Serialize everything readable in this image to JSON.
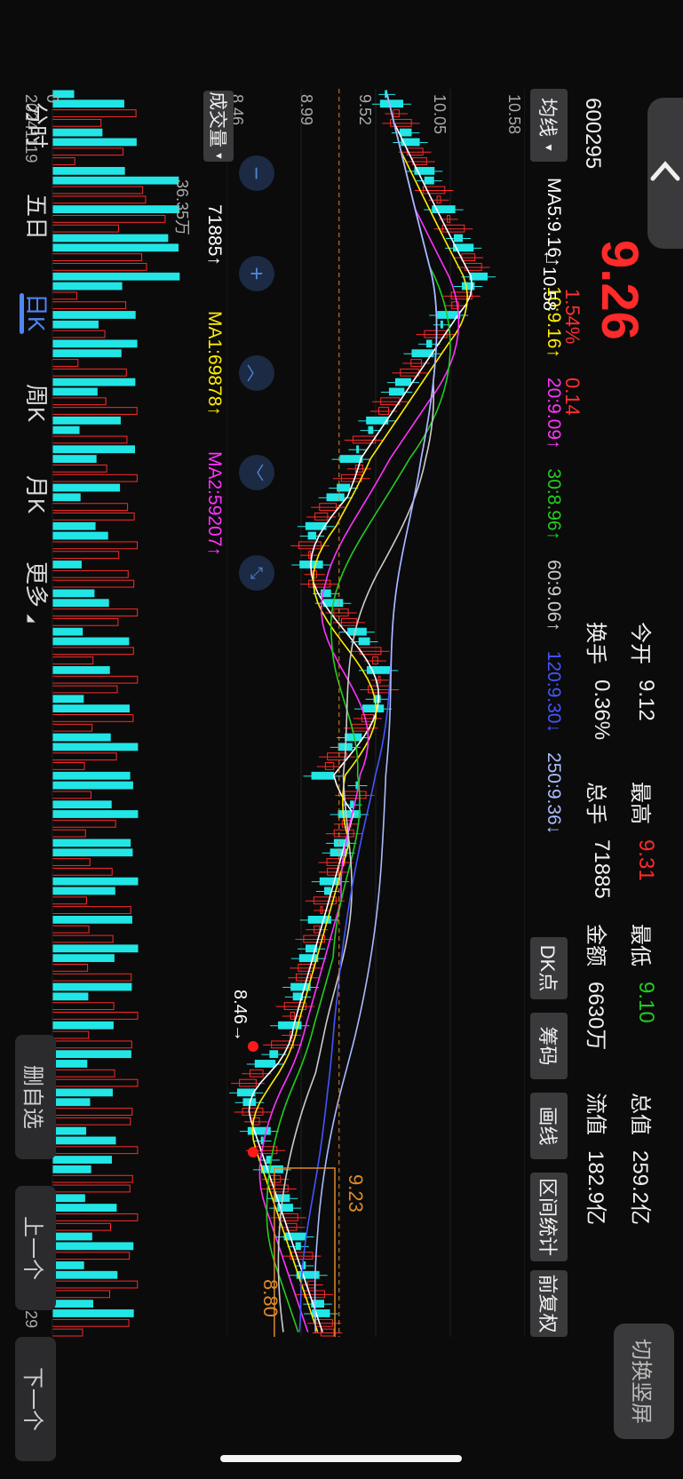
{
  "header": {
    "code": "600295",
    "price": "9.26",
    "change_pct": "1.54%",
    "change_abs": "0.14",
    "quotes": [
      {
        "label": "今开",
        "value": "9.12",
        "color": "#f0f0f0"
      },
      {
        "label": "最高",
        "value": "9.31",
        "color": "#ff2a2a"
      },
      {
        "label": "最低",
        "value": "9.10",
        "color": "#22cc22"
      },
      {
        "label": "总值",
        "value": "259.2亿",
        "color": "#f0f0f0"
      },
      {
        "label": "换手",
        "value": "0.36%",
        "color": "#f0f0f0"
      },
      {
        "label": "总手",
        "value": "71885",
        "color": "#f0f0f0"
      },
      {
        "label": "金额",
        "value": "6630万",
        "color": "#f0f0f0"
      },
      {
        "label": "流值",
        "value": "182.9亿",
        "color": "#f0f0f0"
      }
    ],
    "switch_label": "切换竖屏"
  },
  "toolbar": {
    "ma_select": "均线",
    "tools": [
      "DK点",
      "筹码",
      "画线",
      "区间统计",
      "前复权"
    ]
  },
  "ma": {
    "ma5": "MA5:9.16↑",
    "ma10": "10:9.16↑",
    "ma20": "20:9.09↑",
    "ma30": "30:8.96↑",
    "ma60": "60:9.06↑",
    "ma120": "120:9.30↓",
    "ma250": "250:9.36↓",
    "colors": {
      "ma5": "#ffffff",
      "ma10": "#ffee00",
      "ma20": "#ff33ff",
      "ma30": "#22cc22",
      "ma60": "#cccccc",
      "ma120": "#4455ff",
      "ma250": "#aabbff"
    }
  },
  "chart": {
    "y_top": "10.58",
    "y_second": "10.05",
    "y_third": "9.52",
    "y_fourth": "8.99",
    "y_bottom": "8.46",
    "high_marker": "←10.58",
    "low_marker": "8.46→",
    "box_high": "9.23",
    "box_low": "8.80"
  },
  "volume": {
    "select": "成交量",
    "value": "71885↑",
    "ma1": "MA1:69878↑",
    "ma2": "MA2:59207↑",
    "y_top": "36.35万",
    "y_bottom": "0",
    "date_start": "20241119",
    "date_end": "20250529"
  },
  "bottom_tabs": [
    "分时",
    "五日",
    "日K",
    "周K",
    "月K",
    "更多"
  ],
  "active_tab": "日K",
  "side_buttons": [
    "删自选",
    "上一个",
    "下一个"
  ]
}
